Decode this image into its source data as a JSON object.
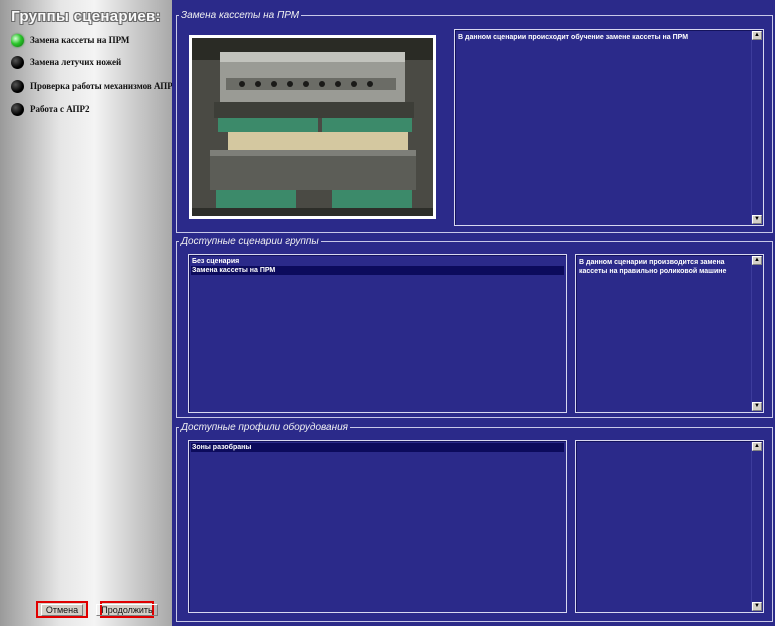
{
  "sidebar": {
    "title": "Группы сценариев:",
    "items": [
      {
        "label": "Замена кассеты на ПРМ",
        "active": true
      },
      {
        "label": "Замена летучих ножей",
        "active": false
      },
      {
        "label": "Проверка работы механизмов АПР",
        "active": false
      },
      {
        "label": "Работа с АПР2",
        "active": false
      }
    ],
    "cancel_label": "Отмена",
    "continue_label": "Продолжить"
  },
  "scenario_section": {
    "legend": "Замена кассеты на ПРМ",
    "description": "В данном сценарии происходит обучение замене кассеты на ПРМ",
    "image_icon": "machine-photo"
  },
  "group_section": {
    "legend": "Доступные сценарии группы",
    "items": [
      "Без сценария",
      "Замена кассеты на ПРМ"
    ],
    "selected_index": 1,
    "description": "В данном сценарии производится замена кассеты на правильно роликовой машине"
  },
  "profiles_section": {
    "legend": "Доступные профили оборудования",
    "items": [
      "Зоны разобраны"
    ],
    "selected_index": 0,
    "description": ""
  },
  "colors": {
    "panel_bg": "#2b2a8a",
    "sidebar_active": "#2bc62b",
    "button_border": "#e00000"
  }
}
